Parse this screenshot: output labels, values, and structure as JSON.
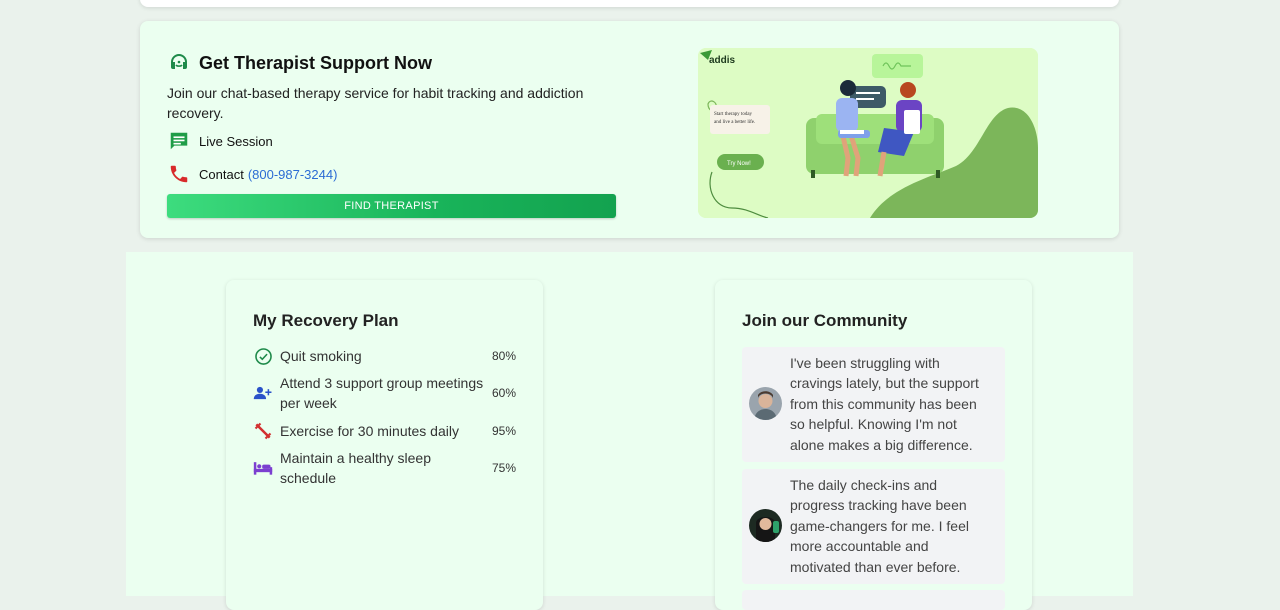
{
  "support": {
    "title": "Get Therapist Support Now",
    "description": "Join our chat-based therapy service for habit tracking and addiction recovery.",
    "live_session_label": "Live Session",
    "contact_label": "Contact",
    "contact_phone": "(800-987-3244)",
    "button_label": "FIND THERAPIST",
    "illustration": {
      "brand": "addis",
      "bubble_text_line1": "Start therapy today",
      "bubble_text_line2": "and live a better life.",
      "cta_label": "Try Now!"
    }
  },
  "recovery_plan": {
    "title": "My Recovery Plan",
    "goals": [
      {
        "icon": "check-circle-icon",
        "label": "Quit smoking",
        "percent": "80%",
        "color": "#1e8a4a"
      },
      {
        "icon": "group-add-icon",
        "label": "Attend 3 support group meetings per week",
        "percent": "60%",
        "color": "#2a52c9"
      },
      {
        "icon": "dumbbell-icon",
        "label": "Exercise for 30 minutes daily",
        "percent": "95%",
        "color": "#d23030"
      },
      {
        "icon": "bed-icon",
        "label": "Maintain a healthy sleep schedule",
        "percent": "75%",
        "color": "#7b3fd0"
      }
    ]
  },
  "community": {
    "title": "Join our Community",
    "posts": [
      {
        "avatar": "avatar-man",
        "text": "I've been struggling with cravings lately, but the support from this community has been so helpful. Knowing I'm not alone makes a big difference."
      },
      {
        "avatar": "avatar-woman",
        "text": "The daily check-ins and progress tracking have been game-changers for me. I feel more accountable and motivated than ever before."
      }
    ]
  },
  "colors": {
    "accent_green": "#19b45a",
    "card_background": "#ebfff0",
    "page_background": "#eaf2ec",
    "link_blue": "#2b6cd4"
  }
}
